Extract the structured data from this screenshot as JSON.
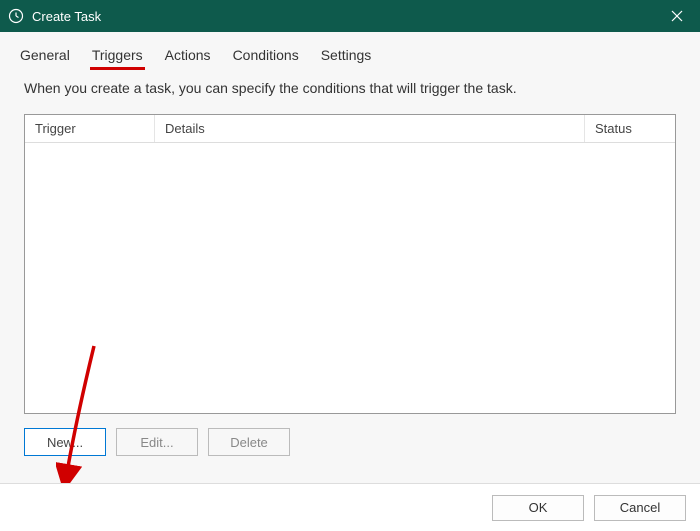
{
  "window": {
    "title": "Create Task"
  },
  "tabs": {
    "general": "General",
    "triggers": "Triggers",
    "actions": "Actions",
    "conditions": "Conditions",
    "settings": "Settings"
  },
  "description": "When you create a task, you can specify the conditions that will trigger the task.",
  "columns": {
    "trigger": "Trigger",
    "details": "Details",
    "status": "Status"
  },
  "buttons": {
    "new": "New...",
    "edit": "Edit...",
    "delete": "Delete",
    "ok": "OK",
    "cancel": "Cancel"
  }
}
